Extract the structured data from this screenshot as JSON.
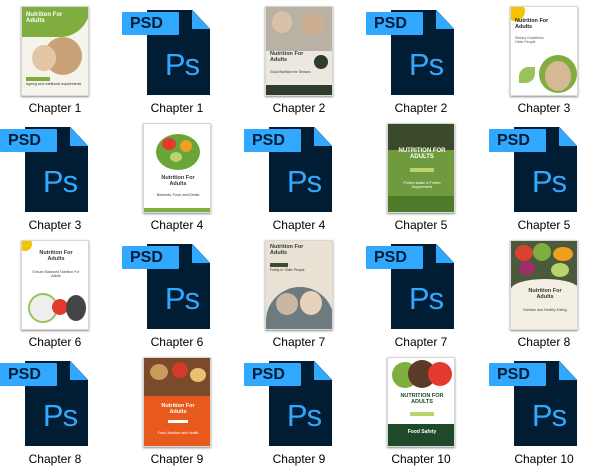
{
  "files": [
    {
      "name": "Chapter 1",
      "type": "cover",
      "cover_title": "Nutrition For Adults",
      "cover_subtitle": "Ageing and nutritional requirements",
      "cover_caption": "Chapter 1",
      "accent": "#7fae3f"
    },
    {
      "name": "Chapter 1",
      "type": "psd",
      "icon": "photoshop-psd-icon"
    },
    {
      "name": "Chapter 2",
      "type": "cover",
      "cover_title": "Nutrition For Adults",
      "cover_subtitle": "Good Nutrition for Seniors",
      "cover_caption": "CHAPTER 2",
      "accent": "#2f3c2d"
    },
    {
      "name": "Chapter 2",
      "type": "psd",
      "icon": "photoshop-psd-icon"
    },
    {
      "name": "Chapter 3",
      "type": "cover",
      "cover_title": "Nutrition For Adults",
      "cover_subtitle": "Dietary Guidelines Older People",
      "cover_caption": "Chapter 3",
      "accent": "#f2c400"
    },
    {
      "name": "Chapter 3",
      "type": "psd",
      "icon": "photoshop-psd-icon"
    },
    {
      "name": "Chapter 4",
      "type": "cover",
      "cover_title": "Nutrition For Adults",
      "cover_subtitle": "Nutrients, Food, and Drinks",
      "cover_caption": "CHAPTER 4",
      "accent": "#7fae3f"
    },
    {
      "name": "Chapter 4",
      "type": "psd",
      "icon": "photoshop-psd-icon"
    },
    {
      "name": "Chapter 5",
      "type": "cover",
      "cover_title": "NUTRITION FOR ADULTS",
      "cover_subtitle": "Protein Intake & Protein Supplements",
      "cover_caption": "CHAPTER 5",
      "accent": "#5f8a33"
    },
    {
      "name": "Chapter 5",
      "type": "psd",
      "icon": "photoshop-psd-icon"
    },
    {
      "name": "Chapter 6",
      "type": "cover",
      "cover_title": "Nutrition For Adults",
      "cover_subtitle": "Ensure Balanced Nutrition For Adults",
      "cover_caption": "CHAPTER 6",
      "accent": "#7fae3f"
    },
    {
      "name": "Chapter 6",
      "type": "psd",
      "icon": "photoshop-psd-icon"
    },
    {
      "name": "Chapter 7",
      "type": "cover",
      "cover_title": "Nutrition For Adults",
      "cover_subtitle": "Frailty in Older People",
      "cover_caption": "CHAPTER 7",
      "accent": "#3a4a33"
    },
    {
      "name": "Chapter 7",
      "type": "psd",
      "icon": "photoshop-psd-icon"
    },
    {
      "name": "Chapter 8",
      "type": "cover",
      "cover_title": "Nutrition For Adults",
      "cover_subtitle": "Nutrition and Healthy Eating",
      "cover_caption": "CHAPTER 8",
      "accent": "#8a2e1f"
    },
    {
      "name": "Chapter 8",
      "type": "psd",
      "icon": "photoshop-psd-icon"
    },
    {
      "name": "Chapter 9",
      "type": "cover",
      "cover_title": "Nutrition For Adults",
      "cover_subtitle": "Food, Nutrition and Health",
      "cover_caption": "CHAPTER 9",
      "accent": "#e85a1c"
    },
    {
      "name": "Chapter 9",
      "type": "psd",
      "icon": "photoshop-psd-icon"
    },
    {
      "name": "Chapter 10",
      "type": "cover",
      "cover_title": "NUTRITION FOR ADULTS",
      "cover_subtitle": "Food Safety",
      "cover_caption": "CHAPTER 10",
      "accent": "#1f4a2a"
    },
    {
      "name": "Chapter 10",
      "type": "psd",
      "icon": "photoshop-psd-icon"
    }
  ],
  "psd_icon": {
    "tag": "PSD",
    "glyph": "Ps",
    "bg": "#001d33",
    "fg": "#31a8ff"
  }
}
